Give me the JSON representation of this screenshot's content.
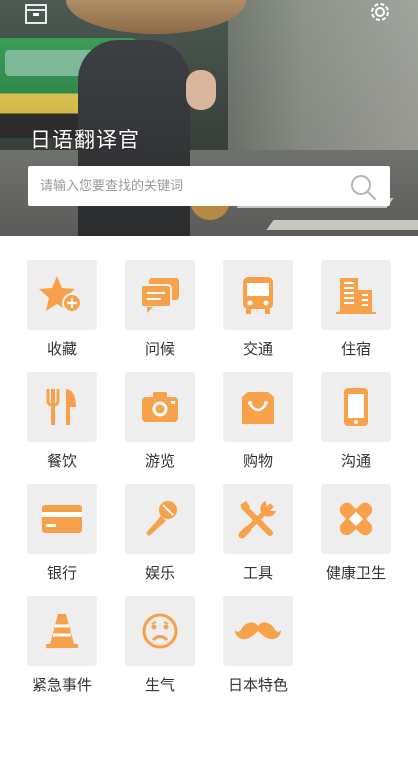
{
  "app": {
    "title": "日语翻译官"
  },
  "search": {
    "placeholder": "请输入您要查找的关键词"
  },
  "accent": "#F7A24B",
  "topbar": {
    "left_icon": "box-icon",
    "right_icon": "gear-icon"
  },
  "categories": [
    {
      "label": "收藏",
      "icon": "star-add-icon"
    },
    {
      "label": "问候",
      "icon": "chat-bubbles-icon"
    },
    {
      "label": "交通",
      "icon": "bus-icon"
    },
    {
      "label": "住宿",
      "icon": "buildings-icon"
    },
    {
      "label": "餐饮",
      "icon": "cutlery-icon"
    },
    {
      "label": "游览",
      "icon": "camera-icon"
    },
    {
      "label": "购物",
      "icon": "shopping-bag-icon"
    },
    {
      "label": "沟通",
      "icon": "phone-icon"
    },
    {
      "label": "银行",
      "icon": "credit-card-icon"
    },
    {
      "label": "娱乐",
      "icon": "microphone-icon"
    },
    {
      "label": "工具",
      "icon": "tools-icon"
    },
    {
      "label": "健康卫生",
      "icon": "bandage-icon"
    },
    {
      "label": "紧急事件",
      "icon": "traffic-cone-icon"
    },
    {
      "label": "生气",
      "icon": "sad-face-icon"
    },
    {
      "label": "日本特色",
      "icon": "mustache-icon"
    }
  ]
}
